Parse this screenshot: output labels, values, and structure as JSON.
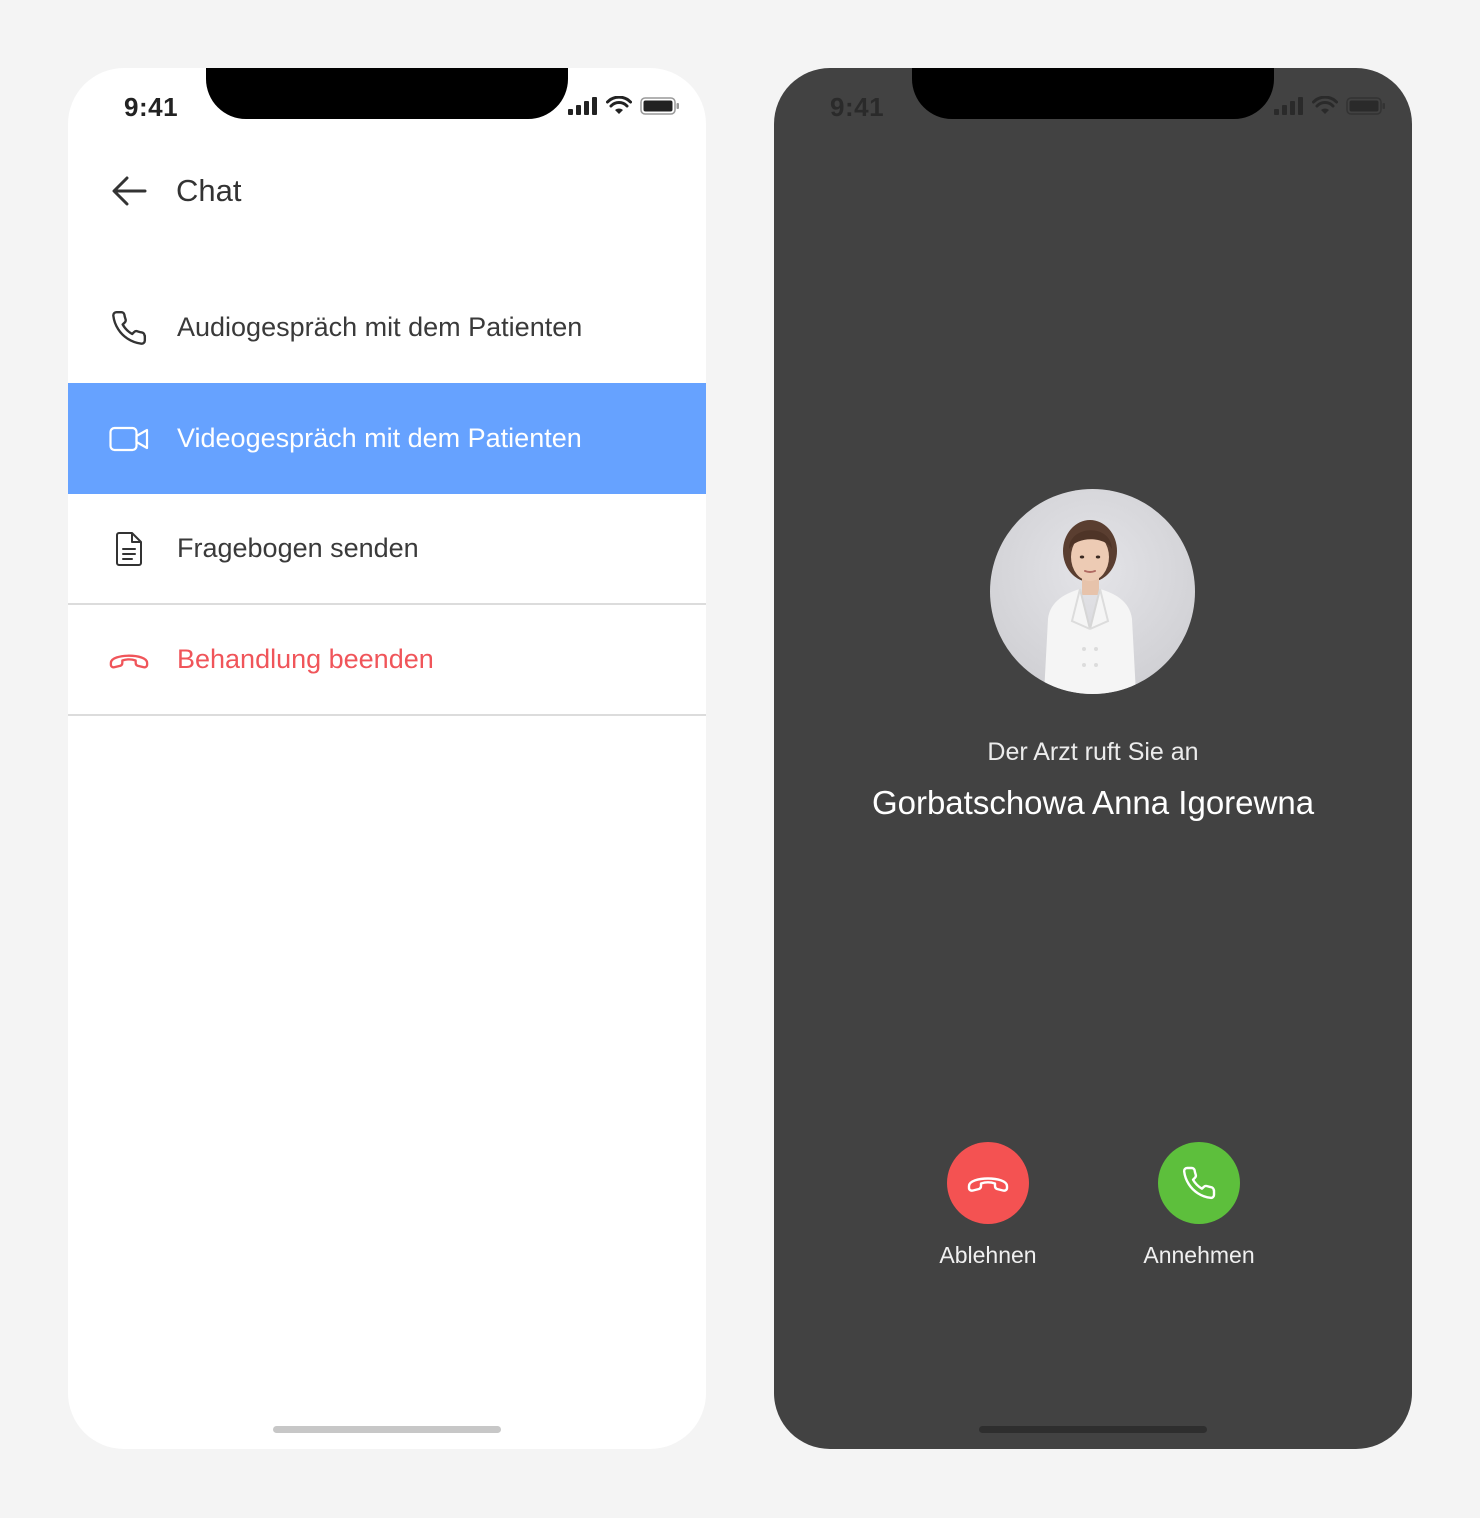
{
  "left_phone": {
    "status": {
      "time": "9:41"
    },
    "header": {
      "title": "Chat"
    },
    "menu": [
      {
        "label": "Audiogespräch mit dem Patienten",
        "icon": "phone-icon",
        "active": false
      },
      {
        "label": "Videogespräch mit dem Patienten",
        "icon": "video-camera-icon",
        "active": true
      },
      {
        "label": "Fragebogen senden",
        "icon": "document-icon",
        "active": false
      },
      {
        "label": "Behandlung beenden",
        "icon": "hang-up-icon",
        "active": false,
        "danger": true
      }
    ]
  },
  "right_phone": {
    "status": {
      "time": "9:41"
    },
    "caller": {
      "subtitle": "Der Arzt ruft Sie an",
      "name": "Gorbatschowa Anna Igorewna"
    },
    "actions": {
      "decline_label": "Ablehnen",
      "accept_label": "Annehmen"
    }
  },
  "colors": {
    "active_item": "#66a2ff",
    "danger": "#f0555a",
    "decline": "#f45252",
    "accept": "#5dbf3c",
    "dark_background": "#424242"
  }
}
